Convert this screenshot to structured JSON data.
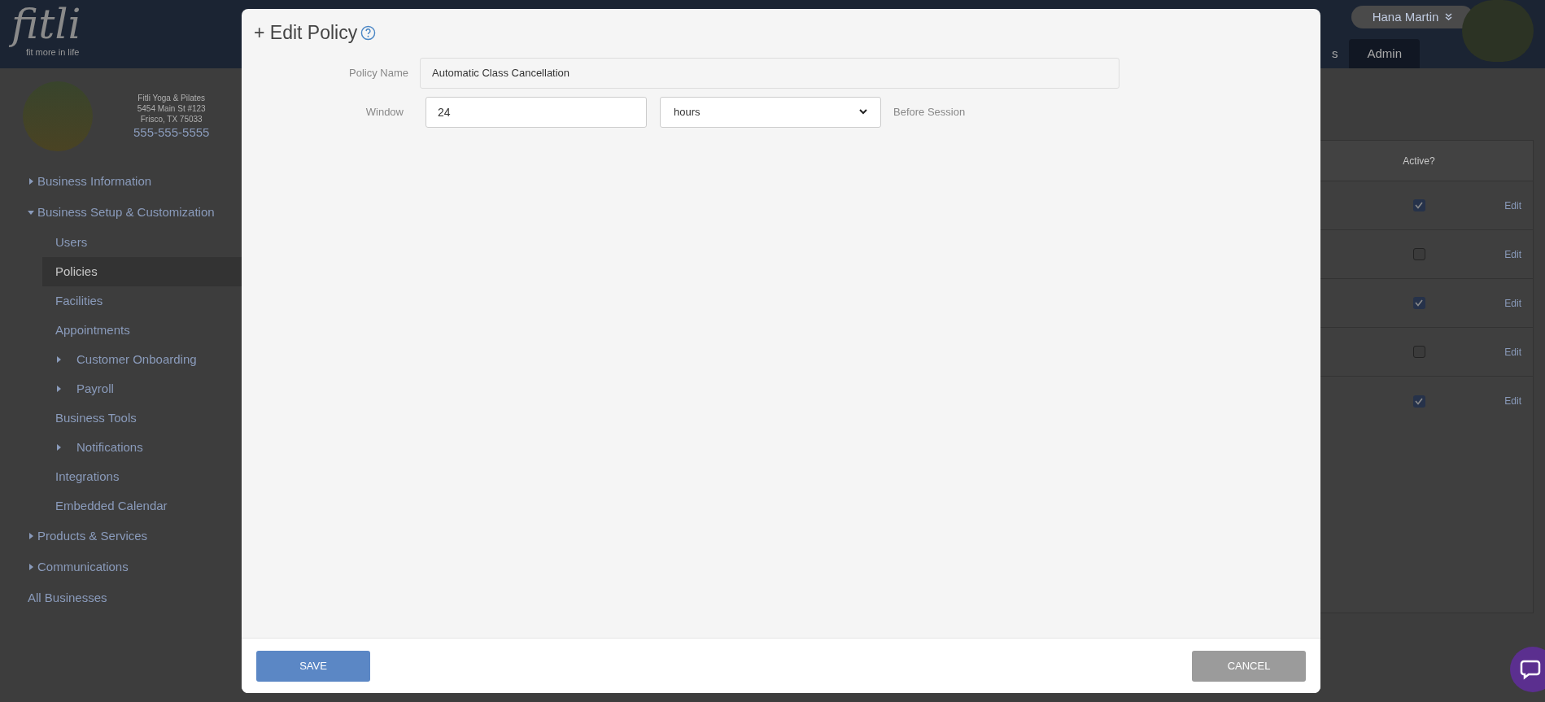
{
  "header": {
    "logo": "fitli",
    "tagline": "fit more in life",
    "tabs": [
      {
        "label": "s",
        "selected": false
      },
      {
        "label": "Admin",
        "selected": true
      }
    ],
    "user": {
      "name": "Hana Martin"
    }
  },
  "business": {
    "name": "Fitli Yoga & Pilates",
    "address": "5454 Main St #123",
    "city": "Frisco, TX 75033",
    "phone": "555-555-5555"
  },
  "sidebar": {
    "items": [
      {
        "label": "Business Information",
        "expanded": false,
        "selected": false
      },
      {
        "label": "Business Setup & Customization",
        "expanded": true,
        "selected": false,
        "children": [
          {
            "label": "Users",
            "selected": false
          },
          {
            "label": "Policies",
            "selected": true
          },
          {
            "label": "Facilities",
            "selected": false
          },
          {
            "label": "Appointments",
            "selected": false
          },
          {
            "label": "Customer Onboarding",
            "selected": false,
            "expanded": false,
            "has_children": true
          },
          {
            "label": "Payroll",
            "selected": false,
            "expanded": false,
            "has_children": true
          },
          {
            "label": "Business Tools",
            "selected": false
          },
          {
            "label": "Notifications",
            "selected": false,
            "expanded": false,
            "has_children": true
          },
          {
            "label": "Integrations",
            "selected": false
          },
          {
            "label": "Embedded Calendar",
            "selected": false
          }
        ]
      },
      {
        "label": "Products & Services",
        "expanded": false,
        "selected": false
      },
      {
        "label": "Communications",
        "expanded": false,
        "selected": false
      },
      {
        "label": "All Businesses",
        "selected": false
      }
    ]
  },
  "table": {
    "columns": [
      "Active?"
    ],
    "rows": [
      {
        "active": true,
        "action": "Edit"
      },
      {
        "active": false,
        "action": "Edit"
      },
      {
        "active": true,
        "action": "Edit"
      },
      {
        "active": false,
        "action": "Edit"
      },
      {
        "active": true,
        "action": "Edit"
      }
    ]
  },
  "modal": {
    "title": "+ Edit Policy",
    "fields": [
      {
        "label": "Policy Name",
        "value": "Automatic Class Cancellation"
      }
    ],
    "window": {
      "label": "Window",
      "value": "24",
      "unit": "hours",
      "suffix": "Before Session"
    },
    "buttons": [
      {
        "label": "SAVE",
        "kind": "primary"
      },
      {
        "label": "CANCEL",
        "kind": "secondary"
      }
    ]
  }
}
